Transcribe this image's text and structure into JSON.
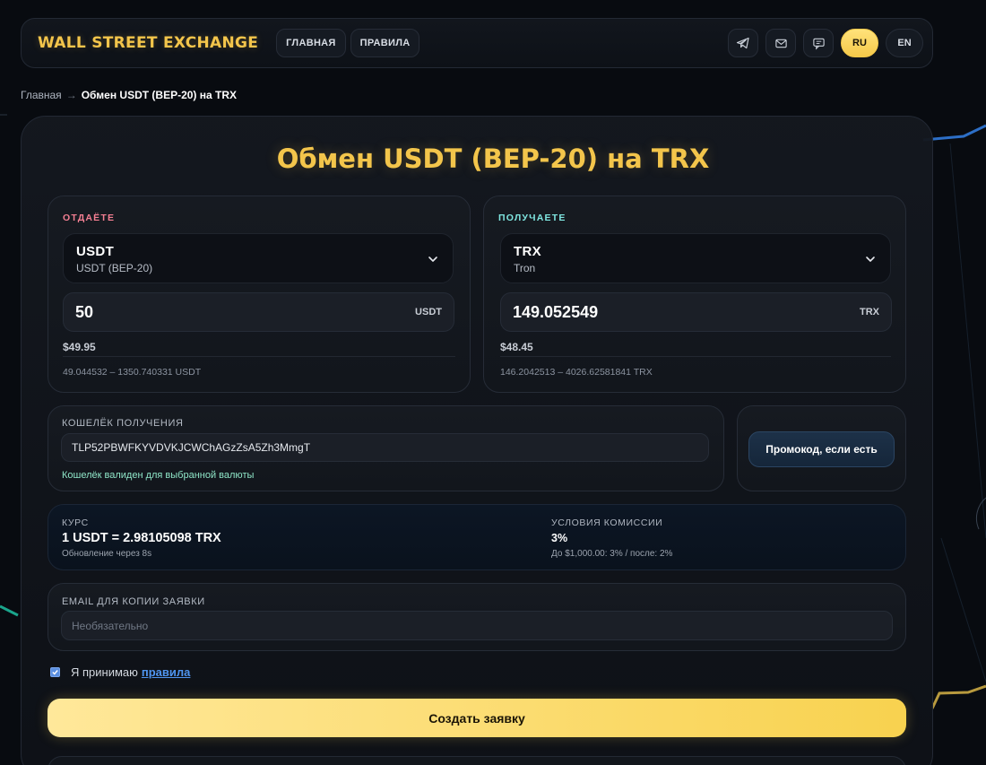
{
  "header": {
    "brand": "WALL STREET EXCHANGE",
    "nav": [
      "ГЛАВНАЯ",
      "ПРАВИЛА"
    ],
    "icons": [
      "telegram-icon",
      "mail-icon",
      "chat-icon"
    ],
    "langs": [
      "RU",
      "EN"
    ],
    "active_lang": "RU"
  },
  "breadcrumb": {
    "home": "Главная",
    "separator": "→",
    "current": "Обмен USDT (BEP-20) на TRX"
  },
  "title": "Обмен USDT (BEP-20) на TRX",
  "give": {
    "label": "ОТДАЁТЕ",
    "code": "USDT",
    "network": "USDT (BEP-20)",
    "amount": "50",
    "unit": "USDT",
    "usd": "$49.95",
    "limits": "49.044532 – 1350.740331 USDT"
  },
  "get": {
    "label": "ПОЛУЧАЕТЕ",
    "code": "TRX",
    "network": "Tron",
    "amount": "149.052549",
    "unit": "TRX",
    "usd": "$48.45",
    "limits": "146.2042513 – 4026.62581841 TRX"
  },
  "wallet": {
    "label": "КОШЕЛЁК ПОЛУЧЕНИЯ",
    "value": "TLP52PBWFKYVDVKJCWChAGzZsA5Zh3MmgT",
    "status": "Кошелёк валиден для выбранной валюты"
  },
  "promo": {
    "label": "Промокод, если есть"
  },
  "rate": {
    "label": "КУРС",
    "value": "1 USDT = 2.98105098 TRX",
    "update": "Обновление через 8s",
    "fee_label": "УСЛОВИЯ КОМИССИИ",
    "fee_value": "3%",
    "fee_note": "До $1,000.00: 3% / после: 2%"
  },
  "email": {
    "label": "EMAIL ДЛЯ КОПИИ ЗАЯВКИ",
    "placeholder": "Необязательно"
  },
  "terms": {
    "text": "Я принимаю",
    "link": "правила",
    "checked": true
  },
  "submit": {
    "label": "Создать заявку"
  },
  "colors": {
    "accent_gold": "#f3c54b",
    "give_label": "#f47f92",
    "get_label": "#7fe6e0",
    "link": "#4f95f0",
    "valid": "#8fe6c8"
  }
}
